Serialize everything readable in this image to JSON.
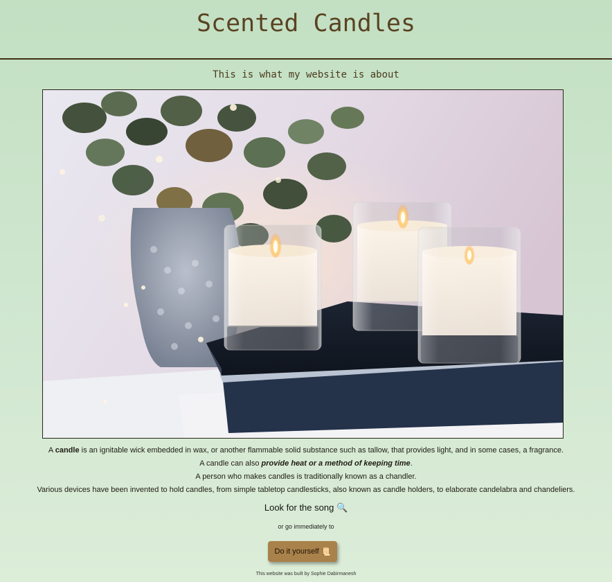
{
  "header": {
    "title": "Scented Candles"
  },
  "subtitle": "This is what my website is about",
  "hero_image": {
    "icon": "candles-photo"
  },
  "description": {
    "line1": {
      "before": "A ",
      "bold": "candle",
      "after": " is an ignitable wick embedded in wax, or another flammable solid substance such as tallow, that provides light, and in some cases, a fragrance."
    },
    "line2": {
      "before": "A candle can also ",
      "emphasis": "provide heat or a method of keeping time",
      "after": "."
    },
    "line3": "A person who makes candles is traditionally known as a chandler.",
    "line4": "Various devices have been invented to hold candles, from simple tabletop candlesticks, also known as candle holders, to elaborate candelabra and chandeliers."
  },
  "song_link": {
    "label": "Look for the song",
    "icon": "magnifier-icon",
    "glyph": "🔍"
  },
  "go_text": "or go immediately to",
  "button": {
    "label": "Do it yourself",
    "icon": "scroll-icon",
    "glyph": "📜"
  },
  "footer": "This website was built by Sophie Dabirmanesh",
  "colors": {
    "background": "#c3e0c3",
    "title": "#5a4322",
    "button": "#a9814a",
    "rule": "#3d2e14"
  }
}
